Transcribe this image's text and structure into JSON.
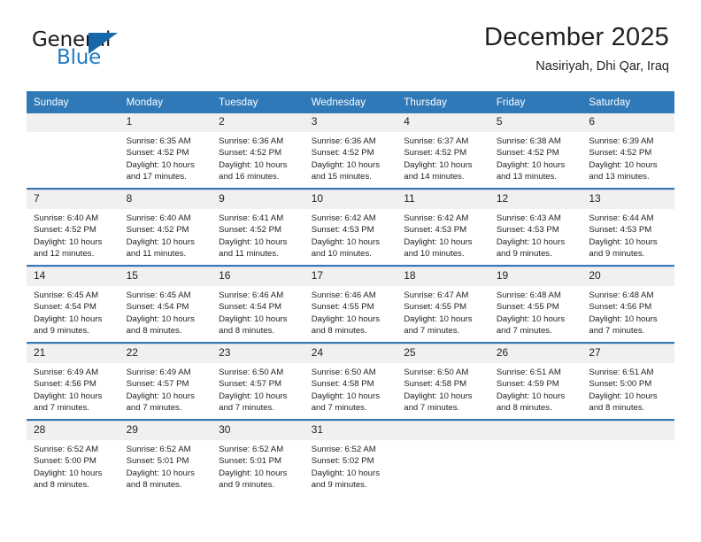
{
  "logo": {
    "text_primary": "General",
    "text_secondary": "Blue",
    "accent_color": "#1767ab",
    "triangle_icon": "triangle-icon"
  },
  "header": {
    "title": "December 2025",
    "subtitle": "Nasiriyah, Dhi Qar, Iraq"
  },
  "colors": {
    "header_blue": "#3079b8",
    "date_band": "#f0f0f0",
    "text": "#231f20",
    "grid_line": "#d4d4d4"
  },
  "weekday_headers": [
    "Sunday",
    "Monday",
    "Tuesday",
    "Wednesday",
    "Thursday",
    "Friday",
    "Saturday"
  ],
  "weeks": [
    [
      {
        "date": "",
        "empty": true,
        "sunrise": "",
        "sunset": "",
        "daylight_line1": "",
        "daylight_line2": ""
      },
      {
        "date": "1",
        "sunrise": "Sunrise: 6:35 AM",
        "sunset": "Sunset: 4:52 PM",
        "daylight_line1": "Daylight: 10 hours",
        "daylight_line2": "and 17 minutes."
      },
      {
        "date": "2",
        "sunrise": "Sunrise: 6:36 AM",
        "sunset": "Sunset: 4:52 PM",
        "daylight_line1": "Daylight: 10 hours",
        "daylight_line2": "and 16 minutes."
      },
      {
        "date": "3",
        "sunrise": "Sunrise: 6:36 AM",
        "sunset": "Sunset: 4:52 PM",
        "daylight_line1": "Daylight: 10 hours",
        "daylight_line2": "and 15 minutes."
      },
      {
        "date": "4",
        "sunrise": "Sunrise: 6:37 AM",
        "sunset": "Sunset: 4:52 PM",
        "daylight_line1": "Daylight: 10 hours",
        "daylight_line2": "and 14 minutes."
      },
      {
        "date": "5",
        "sunrise": "Sunrise: 6:38 AM",
        "sunset": "Sunset: 4:52 PM",
        "daylight_line1": "Daylight: 10 hours",
        "daylight_line2": "and 13 minutes."
      },
      {
        "date": "6",
        "sunrise": "Sunrise: 6:39 AM",
        "sunset": "Sunset: 4:52 PM",
        "daylight_line1": "Daylight: 10 hours",
        "daylight_line2": "and 13 minutes."
      }
    ],
    [
      {
        "date": "7",
        "sunrise": "Sunrise: 6:40 AM",
        "sunset": "Sunset: 4:52 PM",
        "daylight_line1": "Daylight: 10 hours",
        "daylight_line2": "and 12 minutes."
      },
      {
        "date": "8",
        "sunrise": "Sunrise: 6:40 AM",
        "sunset": "Sunset: 4:52 PM",
        "daylight_line1": "Daylight: 10 hours",
        "daylight_line2": "and 11 minutes."
      },
      {
        "date": "9",
        "sunrise": "Sunrise: 6:41 AM",
        "sunset": "Sunset: 4:52 PM",
        "daylight_line1": "Daylight: 10 hours",
        "daylight_line2": "and 11 minutes."
      },
      {
        "date": "10",
        "sunrise": "Sunrise: 6:42 AM",
        "sunset": "Sunset: 4:53 PM",
        "daylight_line1": "Daylight: 10 hours",
        "daylight_line2": "and 10 minutes."
      },
      {
        "date": "11",
        "sunrise": "Sunrise: 6:42 AM",
        "sunset": "Sunset: 4:53 PM",
        "daylight_line1": "Daylight: 10 hours",
        "daylight_line2": "and 10 minutes."
      },
      {
        "date": "12",
        "sunrise": "Sunrise: 6:43 AM",
        "sunset": "Sunset: 4:53 PM",
        "daylight_line1": "Daylight: 10 hours",
        "daylight_line2": "and 9 minutes."
      },
      {
        "date": "13",
        "sunrise": "Sunrise: 6:44 AM",
        "sunset": "Sunset: 4:53 PM",
        "daylight_line1": "Daylight: 10 hours",
        "daylight_line2": "and 9 minutes."
      }
    ],
    [
      {
        "date": "14",
        "sunrise": "Sunrise: 6:45 AM",
        "sunset": "Sunset: 4:54 PM",
        "daylight_line1": "Daylight: 10 hours",
        "daylight_line2": "and 9 minutes."
      },
      {
        "date": "15",
        "sunrise": "Sunrise: 6:45 AM",
        "sunset": "Sunset: 4:54 PM",
        "daylight_line1": "Daylight: 10 hours",
        "daylight_line2": "and 8 minutes."
      },
      {
        "date": "16",
        "sunrise": "Sunrise: 6:46 AM",
        "sunset": "Sunset: 4:54 PM",
        "daylight_line1": "Daylight: 10 hours",
        "daylight_line2": "and 8 minutes."
      },
      {
        "date": "17",
        "sunrise": "Sunrise: 6:46 AM",
        "sunset": "Sunset: 4:55 PM",
        "daylight_line1": "Daylight: 10 hours",
        "daylight_line2": "and 8 minutes."
      },
      {
        "date": "18",
        "sunrise": "Sunrise: 6:47 AM",
        "sunset": "Sunset: 4:55 PM",
        "daylight_line1": "Daylight: 10 hours",
        "daylight_line2": "and 7 minutes."
      },
      {
        "date": "19",
        "sunrise": "Sunrise: 6:48 AM",
        "sunset": "Sunset: 4:55 PM",
        "daylight_line1": "Daylight: 10 hours",
        "daylight_line2": "and 7 minutes."
      },
      {
        "date": "20",
        "sunrise": "Sunrise: 6:48 AM",
        "sunset": "Sunset: 4:56 PM",
        "daylight_line1": "Daylight: 10 hours",
        "daylight_line2": "and 7 minutes."
      }
    ],
    [
      {
        "date": "21",
        "sunrise": "Sunrise: 6:49 AM",
        "sunset": "Sunset: 4:56 PM",
        "daylight_line1": "Daylight: 10 hours",
        "daylight_line2": "and 7 minutes."
      },
      {
        "date": "22",
        "sunrise": "Sunrise: 6:49 AM",
        "sunset": "Sunset: 4:57 PM",
        "daylight_line1": "Daylight: 10 hours",
        "daylight_line2": "and 7 minutes."
      },
      {
        "date": "23",
        "sunrise": "Sunrise: 6:50 AM",
        "sunset": "Sunset: 4:57 PM",
        "daylight_line1": "Daylight: 10 hours",
        "daylight_line2": "and 7 minutes."
      },
      {
        "date": "24",
        "sunrise": "Sunrise: 6:50 AM",
        "sunset": "Sunset: 4:58 PM",
        "daylight_line1": "Daylight: 10 hours",
        "daylight_line2": "and 7 minutes."
      },
      {
        "date": "25",
        "sunrise": "Sunrise: 6:50 AM",
        "sunset": "Sunset: 4:58 PM",
        "daylight_line1": "Daylight: 10 hours",
        "daylight_line2": "and 7 minutes."
      },
      {
        "date": "26",
        "sunrise": "Sunrise: 6:51 AM",
        "sunset": "Sunset: 4:59 PM",
        "daylight_line1": "Daylight: 10 hours",
        "daylight_line2": "and 8 minutes."
      },
      {
        "date": "27",
        "sunrise": "Sunrise: 6:51 AM",
        "sunset": "Sunset: 5:00 PM",
        "daylight_line1": "Daylight: 10 hours",
        "daylight_line2": "and 8 minutes."
      }
    ],
    [
      {
        "date": "28",
        "sunrise": "Sunrise: 6:52 AM",
        "sunset": "Sunset: 5:00 PM",
        "daylight_line1": "Daylight: 10 hours",
        "daylight_line2": "and 8 minutes."
      },
      {
        "date": "29",
        "sunrise": "Sunrise: 6:52 AM",
        "sunset": "Sunset: 5:01 PM",
        "daylight_line1": "Daylight: 10 hours",
        "daylight_line2": "and 8 minutes."
      },
      {
        "date": "30",
        "sunrise": "Sunrise: 6:52 AM",
        "sunset": "Sunset: 5:01 PM",
        "daylight_line1": "Daylight: 10 hours",
        "daylight_line2": "and 9 minutes."
      },
      {
        "date": "31",
        "sunrise": "Sunrise: 6:52 AM",
        "sunset": "Sunset: 5:02 PM",
        "daylight_line1": "Daylight: 10 hours",
        "daylight_line2": "and 9 minutes."
      },
      {
        "date": "",
        "empty": true,
        "sunrise": "",
        "sunset": "",
        "daylight_line1": "",
        "daylight_line2": ""
      },
      {
        "date": "",
        "empty": true,
        "sunrise": "",
        "sunset": "",
        "daylight_line1": "",
        "daylight_line2": ""
      },
      {
        "date": "",
        "empty": true,
        "sunrise": "",
        "sunset": "",
        "daylight_line1": "",
        "daylight_line2": ""
      }
    ]
  ]
}
